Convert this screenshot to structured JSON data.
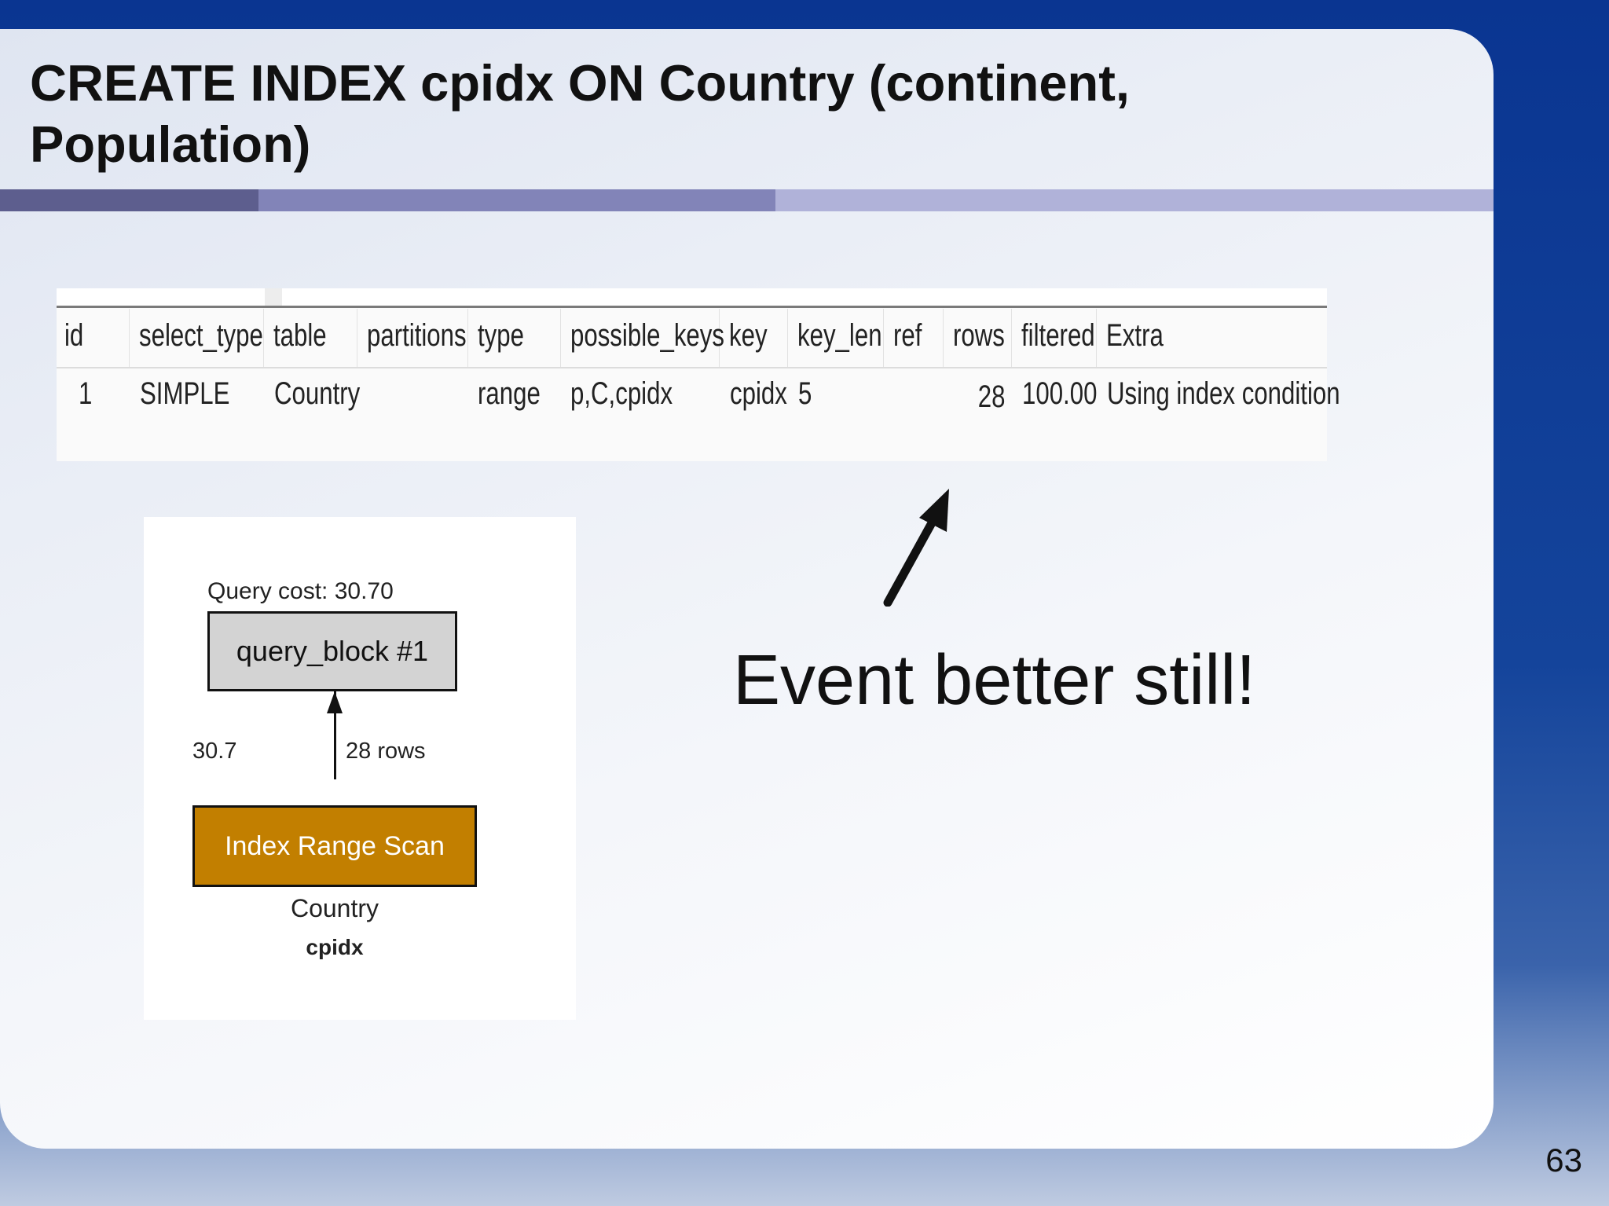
{
  "slide": {
    "title_line1": "CREATE INDEX cpidx ON Country (continent,",
    "title_line2": "Population)",
    "page_number": "63",
    "callout": "Event better still!"
  },
  "explain_table": {
    "headers": [
      "id",
      "select_type",
      "table",
      "partitions",
      "type",
      "possible_keys",
      "key",
      "key_len",
      "ref",
      "rows",
      "filtered",
      "Extra"
    ],
    "row": [
      "1",
      "SIMPLE",
      "Country",
      "",
      "range",
      "p,C,cpidx",
      "cpidx",
      "5",
      "",
      "28",
      "100.00",
      "Using index condition"
    ]
  },
  "plan": {
    "query_cost": "Query cost: 30.70",
    "block_label": "query_block #1",
    "edge_cost": "30.7",
    "edge_rows": "28 rows",
    "scan_label": "Index Range Scan",
    "table_name": "Country",
    "index_name": "cpidx"
  },
  "colors": {
    "frame_blue": "#0a3591",
    "scan_node": "#c27f00",
    "block_node": "#d3d3d3"
  }
}
